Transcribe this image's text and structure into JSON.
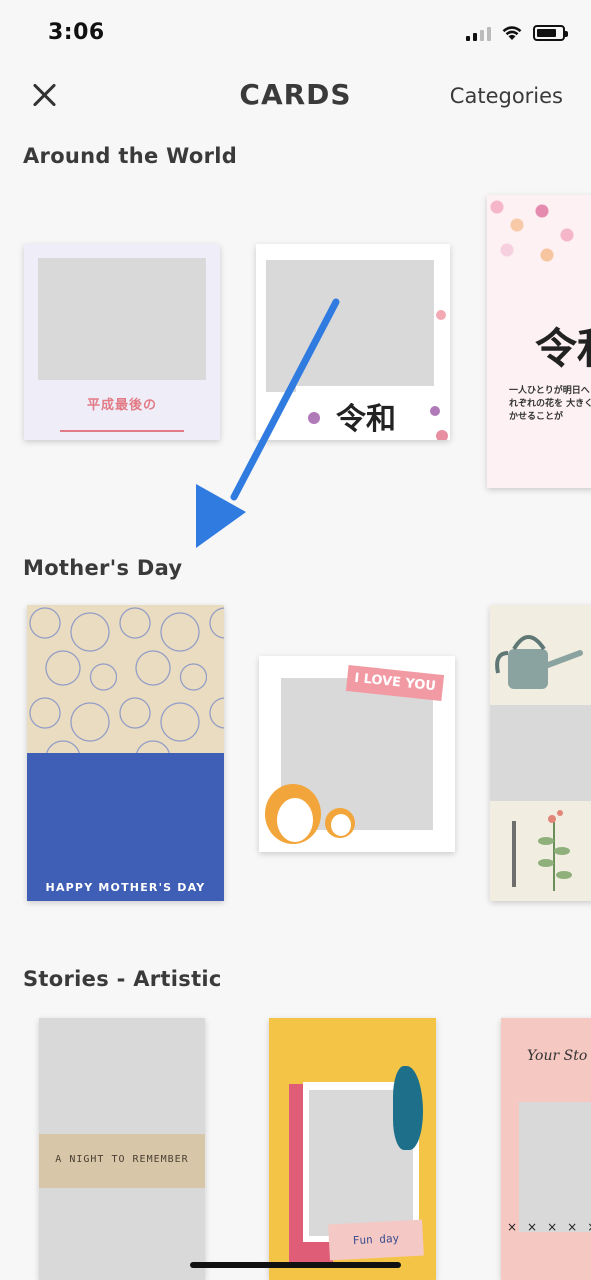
{
  "status_bar": {
    "time": "3:06"
  },
  "nav": {
    "title": "CARDS",
    "categories_label": "Categories"
  },
  "sections": [
    {
      "title": "Around the World",
      "cards": [
        {
          "caption": "平成最後の"
        },
        {
          "caption": "令和"
        },
        {
          "caption": "令和",
          "subtext": "一人ひとりが明日へ それぞれの花を 大きく咲かせることが"
        }
      ]
    },
    {
      "title": "Mother's Day",
      "cards": [
        {
          "caption": "HAPPY MOTHER'S DAY"
        },
        {
          "caption": "I LOVE YOU"
        },
        {
          "caption": ""
        }
      ]
    },
    {
      "title": "Stories - Artistic",
      "cards": [
        {
          "caption": "A NIGHT TO REMEMBER"
        },
        {
          "caption": "Fun day"
        },
        {
          "caption": "Your Sto"
        }
      ]
    }
  ],
  "colors": {
    "background": "#f7f7f7",
    "arrow": "#2f7be0",
    "mothers_day_blue": "#3f5eb5",
    "love_pink": "#f29aa3",
    "stories_yellow": "#f3c446"
  },
  "icons": [
    "close-icon",
    "signal-icon",
    "wifi-icon",
    "battery-icon"
  ]
}
